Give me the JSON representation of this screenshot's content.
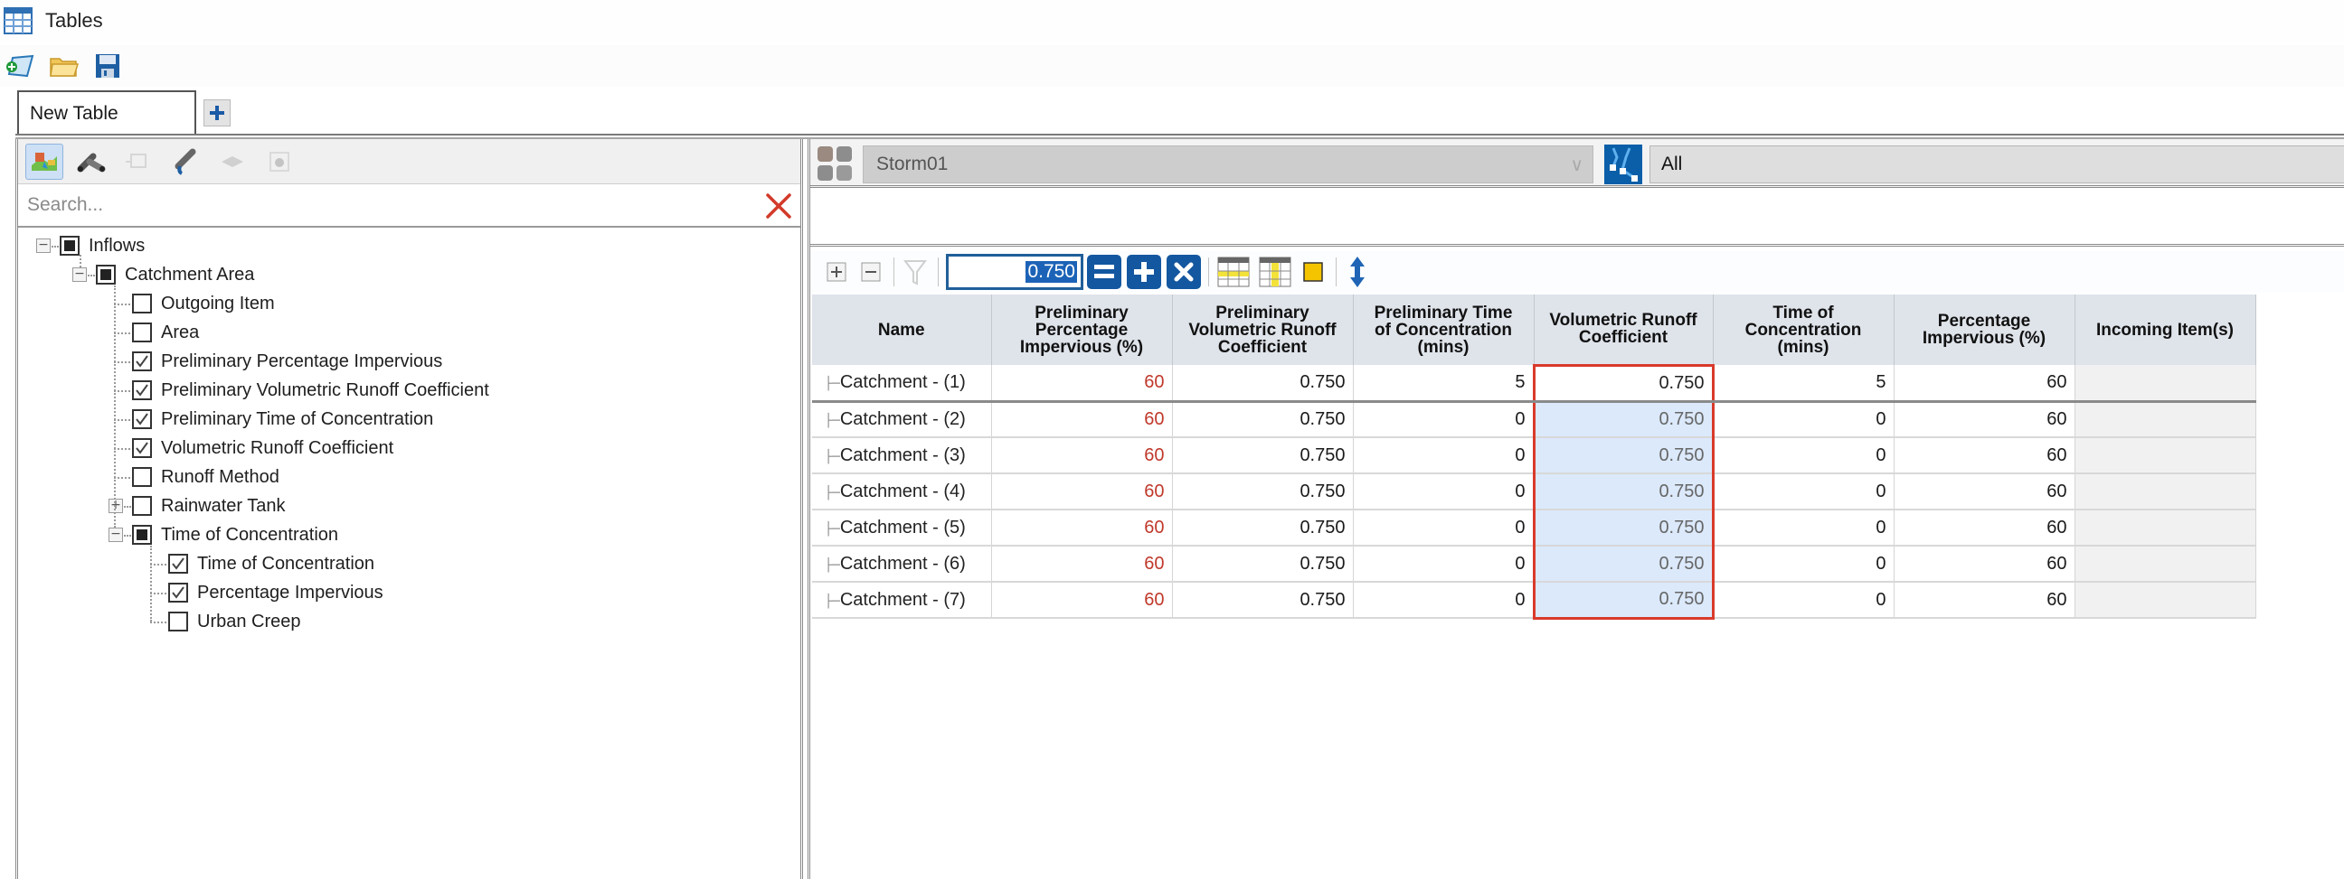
{
  "window": {
    "title": "Tables",
    "icon": "table-icon"
  },
  "top_toolbar": {
    "buttons": [
      {
        "name": "new-table-button",
        "icon": "new-document-icon"
      },
      {
        "name": "open-button",
        "icon": "folder-open-icon"
      },
      {
        "name": "save-button",
        "icon": "floppy-save-icon"
      }
    ]
  },
  "tabs": [
    {
      "label": "New Table",
      "active": true
    }
  ],
  "add_tab_icon": "plus-icon",
  "left_panel": {
    "toolbar": [
      {
        "name": "catchment-type-button",
        "icon": "catchment-icon",
        "active": true
      },
      {
        "name": "pipe-type-button",
        "icon": "pipe-tee-icon",
        "active": false
      },
      {
        "name": "node-type-button",
        "icon": "node-icon",
        "active": false,
        "disabled": true
      },
      {
        "name": "channel-type-button",
        "icon": "pipe-outlet-icon",
        "active": false
      },
      {
        "name": "surface-type-button",
        "icon": "surface-icon",
        "active": false,
        "disabled": true
      },
      {
        "name": "storage-type-button",
        "icon": "storage-icon",
        "active": false,
        "disabled": true
      }
    ],
    "search": {
      "placeholder": "Search...",
      "value": ""
    },
    "tree": [
      {
        "label": "Inflows",
        "level": 0,
        "state": "partial",
        "expander": "minus"
      },
      {
        "label": "Catchment Area",
        "level": 1,
        "state": "partial",
        "expander": "minus"
      },
      {
        "label": "Outgoing Item",
        "level": 2,
        "state": "unchecked"
      },
      {
        "label": "Area",
        "level": 2,
        "state": "unchecked"
      },
      {
        "label": "Preliminary Percentage Impervious",
        "level": 2,
        "state": "checked"
      },
      {
        "label": "Preliminary Volumetric Runoff Coefficient",
        "level": 2,
        "state": "checked"
      },
      {
        "label": "Preliminary Time of Concentration",
        "level": 2,
        "state": "checked"
      },
      {
        "label": "Volumetric Runoff Coefficient",
        "level": 2,
        "state": "checked"
      },
      {
        "label": "Runoff Method",
        "level": 2,
        "state": "unchecked"
      },
      {
        "label": "Rainwater Tank",
        "level": 2,
        "state": "unchecked",
        "expander": "plus"
      },
      {
        "label": "Time of Concentration",
        "level": 2,
        "state": "partial",
        "expander": "minus"
      },
      {
        "label": "Time of Concentration",
        "level": 3,
        "state": "checked"
      },
      {
        "label": "Percentage Impervious",
        "level": 3,
        "state": "checked"
      },
      {
        "label": "Urban Creep",
        "level": 3,
        "state": "unchecked"
      }
    ]
  },
  "right_panel": {
    "scenario": {
      "value": "Storm01",
      "icon": "scenario-icon"
    },
    "filter": {
      "value": "All",
      "icon": "network-filter-icon"
    },
    "expression": "",
    "grid_toolbar": {
      "value_input": "0.750",
      "buttons": [
        "expand-icon",
        "collapse-icon",
        "filter-icon",
        "equals-icon",
        "add-icon",
        "multiply-icon",
        "highlight-rows-icon",
        "highlight-columns-icon",
        "highlight-cell-icon",
        "sort-icon"
      ]
    },
    "table": {
      "columns": [
        "Name",
        "Preliminary Percentage Impervious (%)",
        "Preliminary Volumetric Runoff Coefficient",
        "Preliminary Time of Concentration (mins)",
        "Volumetric Runoff Coefficient",
        "Time of Concentration (mins)",
        "Percentage Impervious (%)",
        "Incoming Item(s)"
      ],
      "column_header_lines": [
        [
          "Name"
        ],
        [
          "Preliminary",
          "Percentage",
          "Impervious (%)"
        ],
        [
          "Preliminary",
          "Volumetric Runoff",
          "Coefficient"
        ],
        [
          "Preliminary Time",
          "of Concentration",
          "(mins)"
        ],
        [
          "Volumetric Runoff",
          "Coefficient"
        ],
        [
          "Time of",
          "Concentration",
          "(mins)"
        ],
        [
          "Percentage",
          "Impervious (%)"
        ],
        [
          "Incoming Item(s)"
        ]
      ],
      "rows": [
        [
          "Catchment - (1)",
          "60",
          "0.750",
          "5",
          "0.750",
          "5",
          "60",
          ""
        ],
        [
          "Catchment - (2)",
          "60",
          "0.750",
          "0",
          "0.750",
          "0",
          "60",
          ""
        ],
        [
          "Catchment - (3)",
          "60",
          "0.750",
          "0",
          "0.750",
          "0",
          "60",
          ""
        ],
        [
          "Catchment - (4)",
          "60",
          "0.750",
          "0",
          "0.750",
          "0",
          "60",
          ""
        ],
        [
          "Catchment - (5)",
          "60",
          "0.750",
          "0",
          "0.750",
          "0",
          "60",
          ""
        ],
        [
          "Catchment - (6)",
          "60",
          "0.750",
          "0",
          "0.750",
          "0",
          "60",
          ""
        ],
        [
          "Catchment - (7)",
          "60",
          "0.750",
          "0",
          "0.750",
          "0",
          "60",
          ""
        ]
      ],
      "selected_column": "Volumetric Runoff Coefficient"
    }
  },
  "colors": {
    "accent_blue": "#1357a0",
    "selection_border": "#d93a2b",
    "selection_fill": "#dbe9fb",
    "override_red": "#c0392b",
    "header_bg": "#dfe3ea"
  }
}
